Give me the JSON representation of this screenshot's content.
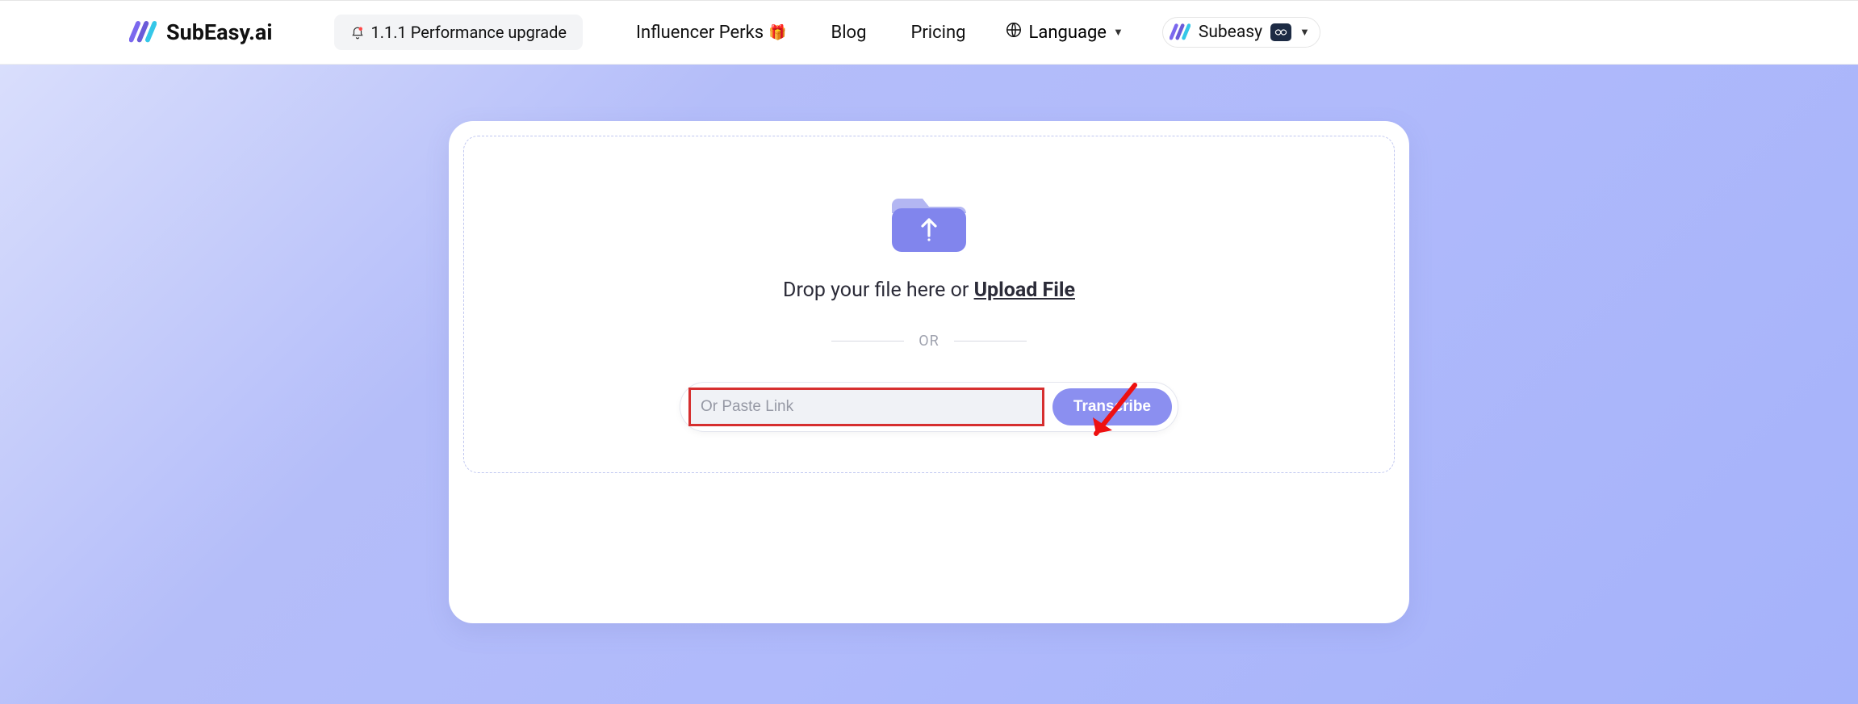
{
  "header": {
    "brand": "SubEasy.ai",
    "banner": "1.1.1 Performance upgrade",
    "nav": {
      "influencer": "Influencer Perks",
      "gift_emoji": "🎁",
      "blog": "Blog",
      "pricing": "Pricing"
    },
    "language_label": "Language",
    "user": {
      "name": "Subeasy"
    }
  },
  "dropzone": {
    "prefix": "Drop your file here or ",
    "upload_label": "Upload File",
    "or_label": "OR",
    "link_placeholder": "Or Paste Link",
    "transcribe_label": "Transcribe"
  }
}
